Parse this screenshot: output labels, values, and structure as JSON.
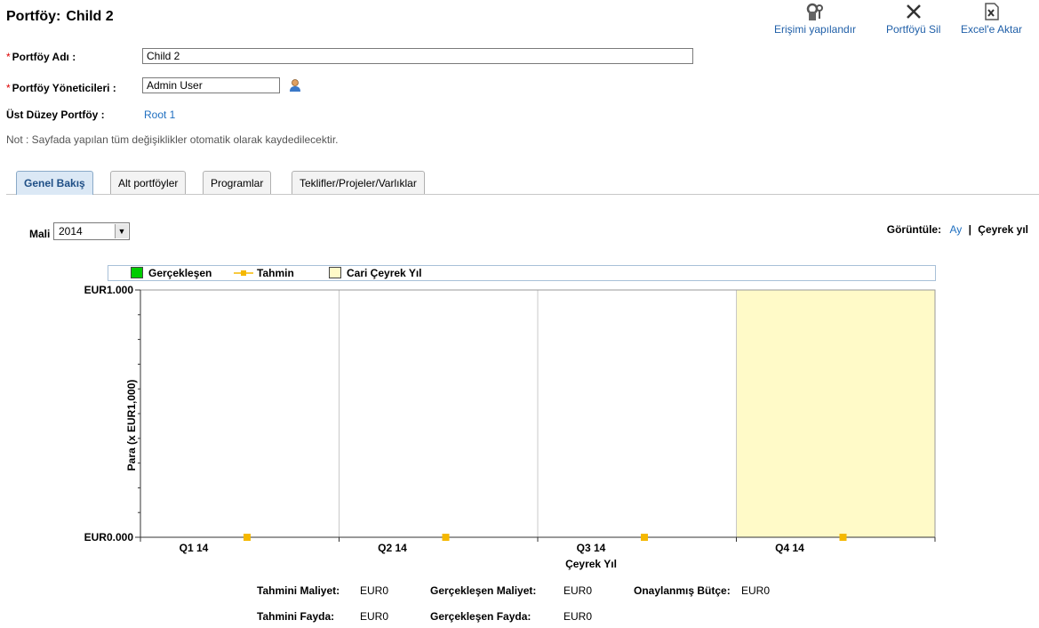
{
  "header": {
    "title_label": "Portföy:",
    "title_value": "Child 2"
  },
  "toolbar": {
    "access_label": "Erişimi yapılandır",
    "delete_label": "Portföyü Sil",
    "export_label": "Excel'e Aktar"
  },
  "form": {
    "name_label": "Portföy Adı :",
    "name_value": "Child 2",
    "managers_label": "Portföy Yöneticileri :",
    "managers_value": "Admin User",
    "parent_label": "Üst Düzey Portföy :",
    "parent_value": "Root 1",
    "required_mark": "*"
  },
  "note": "Not : Sayfada yapılan tüm değişiklikler otomatik olarak kaydedilecektir.",
  "tabs": [
    {
      "label": "Genel Bakış",
      "active": true
    },
    {
      "label": "Alt portföyler",
      "active": false
    },
    {
      "label": "Programlar",
      "active": false
    },
    {
      "label": "Teklifler/Projeler/Varlıklar",
      "active": false
    }
  ],
  "fiscal_year": {
    "label": "Mali Yıl:",
    "value": "2014"
  },
  "view": {
    "label": "Görüntüle:",
    "month": "Ay",
    "separator": "|",
    "quarter": "Çeyrek yıl"
  },
  "legend": {
    "actual": "Gerçekleşen",
    "forecast": "Tahmin",
    "current_quarter": "Cari Çeyrek Yıl"
  },
  "chart_data": {
    "type": "bar",
    "categories": [
      "Q1 14",
      "Q2 14",
      "Q3 14",
      "Q4 14"
    ],
    "series": [
      {
        "name": "Gerçekleşen",
        "values": [
          0,
          0,
          0,
          0
        ]
      },
      {
        "name": "Tahmin",
        "values": [
          0,
          0,
          0,
          0
        ]
      }
    ],
    "highlight_category": "Q4 14",
    "highlight_label": "Cari Çeyrek Yıl",
    "xlabel": "Çeyrek Yıl",
    "ylabel": "Para (x EUR1,000)",
    "y_ticks": [
      "EUR0.000",
      "EUR1.000"
    ],
    "ylim": [
      0,
      1
    ],
    "grid": true,
    "colors": {
      "actual": "#00cc00",
      "forecast": "#f5b800",
      "highlight": "#fffac8"
    }
  },
  "summary": {
    "forecast_cost_label": "Tahmini Maliyet:",
    "forecast_cost_value": "EUR0",
    "actual_cost_label": "Gerçekleşen Maliyet:",
    "actual_cost_value": "EUR0",
    "approved_budget_label": "Onaylanmış Bütçe:",
    "approved_budget_value": "EUR0",
    "forecast_benefit_label": "Tahmini Fayda:",
    "forecast_benefit_value": "EUR0",
    "actual_benefit_label": "Gerçekleşen Fayda:",
    "actual_benefit_value": "EUR0"
  }
}
